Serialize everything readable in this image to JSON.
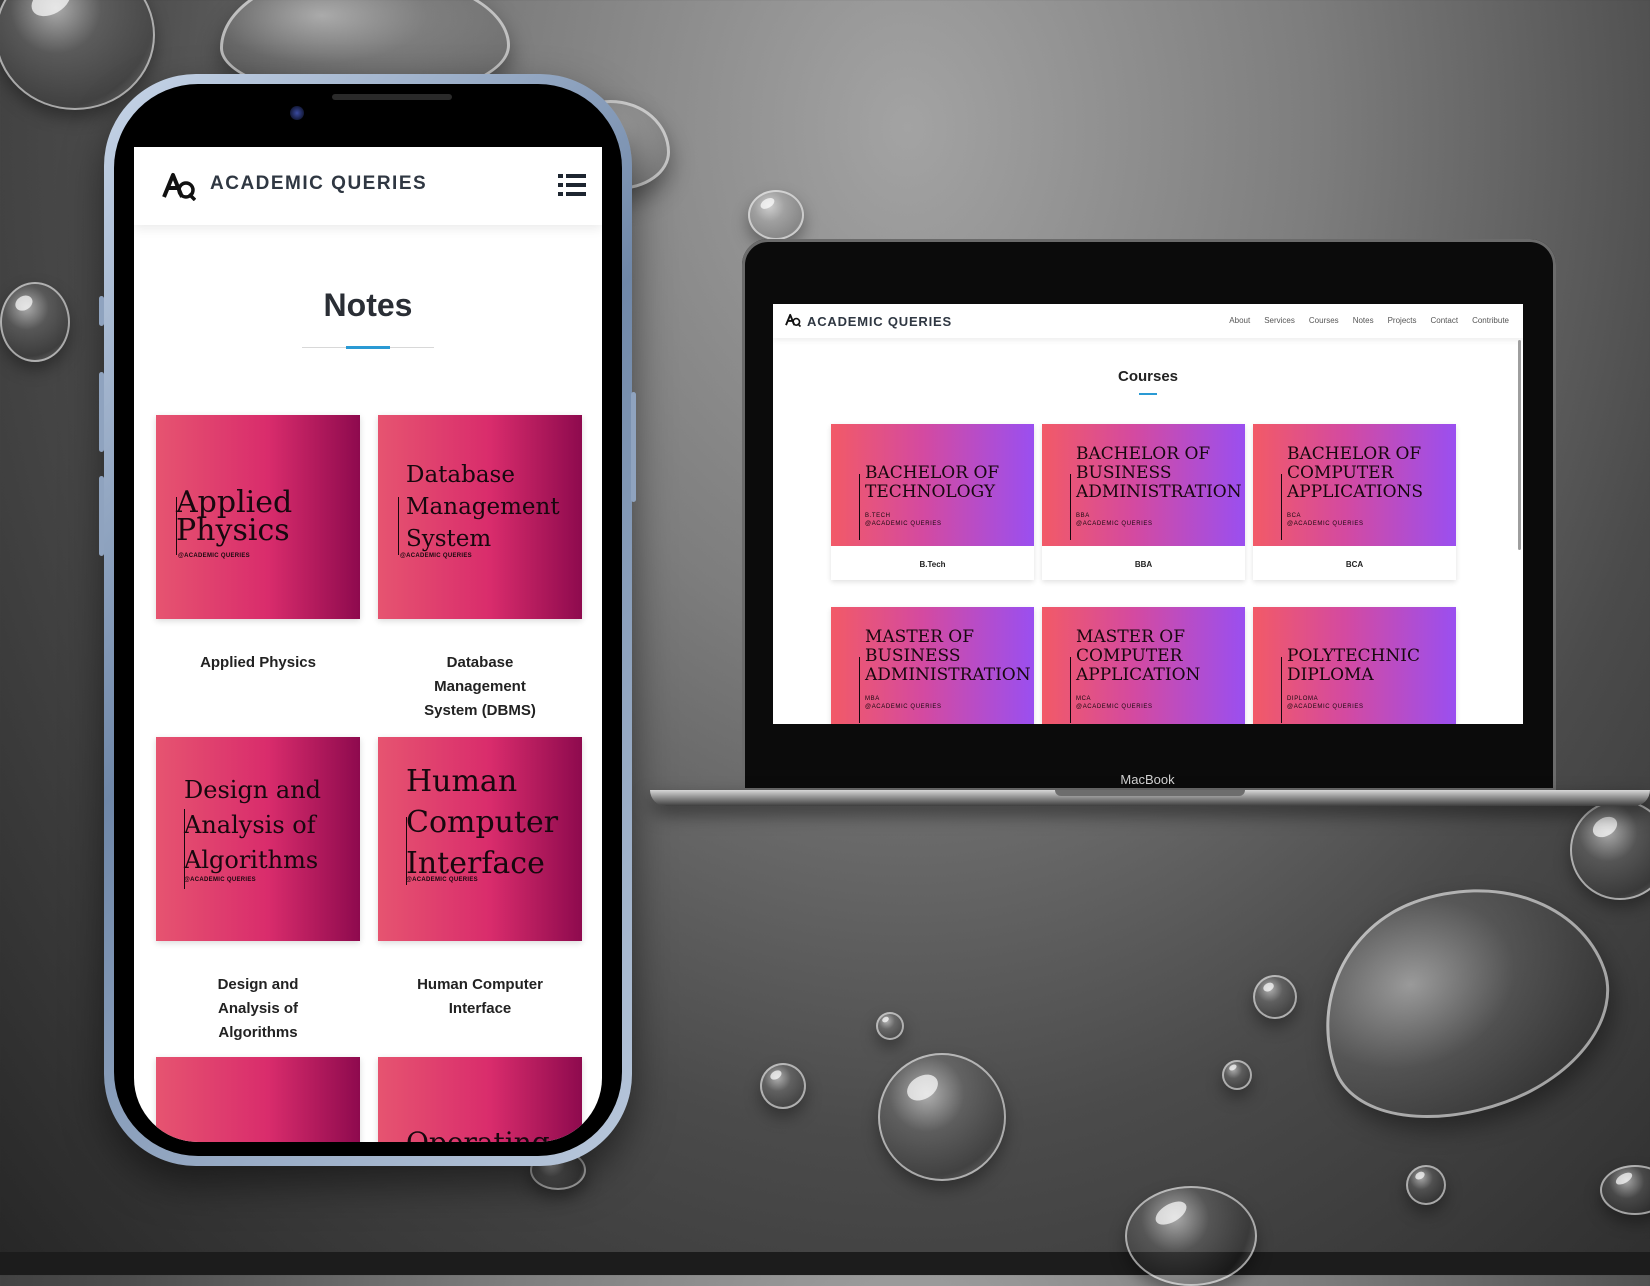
{
  "mobile": {
    "brand": "ACADEMIC QUERIES",
    "page_title": "Notes",
    "cards": [
      {
        "image_title": "Applied\nPhysics",
        "tag": "@ACADEMIC QUERIES",
        "caption": "Applied Physics"
      },
      {
        "image_title": "Database\nManagement\nSystem",
        "tag": "@ACADEMIC QUERIES",
        "caption": "Database\nManagement\nSystem (DBMS)"
      },
      {
        "image_title": "Design and\nAnalysis of\nAlgorithms",
        "tag": "@ACADEMIC QUERIES",
        "caption": "Design and\nAnalysis of\nAlgorithms"
      },
      {
        "image_title": "Human\nComputer\nInterface",
        "tag": "@ACADEMIC QUERIES",
        "caption": "Human Computer\nInterface"
      },
      {
        "image_title": "",
        "tag": "",
        "caption": ""
      },
      {
        "image_title": "Operating",
        "tag": "",
        "caption": ""
      }
    ]
  },
  "desktop": {
    "brand": "ACADEMIC QUERIES",
    "nav": [
      "About",
      "Services",
      "Courses",
      "Notes",
      "Projects",
      "Contact",
      "Contribute"
    ],
    "page_title": "Courses",
    "courses": [
      {
        "image_title": "BACHELOR OF\nTECHNOLOGY",
        "tag": "B.TECH\n@ACADEMIC QUERIES",
        "caption": "B.Tech"
      },
      {
        "image_title": "BACHELOR OF\nBUSINESS\nADMINISTRATION",
        "tag": "BBA\n@ACADEMIC QUERIES",
        "caption": "BBA"
      },
      {
        "image_title": "BACHELOR OF\nCOMPUTER\nAPPLICATIONS",
        "tag": "BCA\n@ACADEMIC QUERIES",
        "caption": "BCA"
      },
      {
        "image_title": "MASTER OF\nBUSINESS\nADMINISTRATION",
        "tag": "MBA\n@ACADEMIC QUERIES",
        "caption": ""
      },
      {
        "image_title": "MASTER OF\nCOMPUTER\nAPPLICATION",
        "tag": "MCA\n@ACADEMIC QUERIES",
        "caption": ""
      },
      {
        "image_title": "POLYTECHNIC\nDIPLOMA",
        "tag": "DIPLOMA\n@ACADEMIC QUERIES",
        "caption": ""
      }
    ]
  },
  "device_label": "MacBook",
  "colors": {
    "accent": "#2a9ad4",
    "notes_card_gradient": [
      "#e65470",
      "#d92c6c",
      "#8e0a4e"
    ],
    "course_card_gradient": [
      "#f25a67",
      "#d44aa0",
      "#9a4ff0"
    ]
  },
  "icons": {
    "logo": "aq-logo-icon",
    "menu": "list-menu-icon"
  }
}
